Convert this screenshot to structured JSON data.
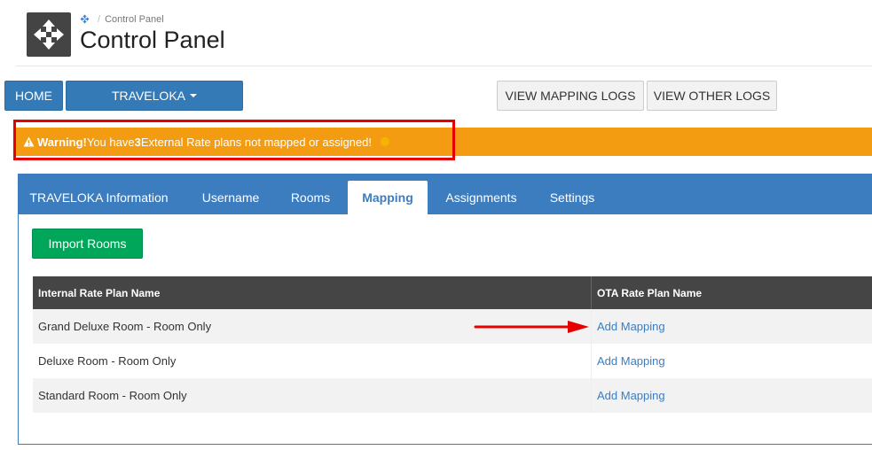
{
  "header": {
    "breadcrumb": "Control Panel",
    "title": "Control Panel",
    "logo_icon": "move-arrows-icon"
  },
  "nav": {
    "home_label": "HOME",
    "ota_label": "TRAVELOKA",
    "mapping_logs_label": "VIEW MAPPING LOGS",
    "other_logs_label": "VIEW OTHER LOGS"
  },
  "warning": {
    "title": "Warning!",
    "text_before": " You have ",
    "count": "3",
    "text_after": " External Rate plans not mapped or assigned!",
    "color": "#f39c12"
  },
  "tabs": [
    {
      "label": "TRAVELOKA Information"
    },
    {
      "label": "Username"
    },
    {
      "label": "Rooms"
    },
    {
      "label": "Mapping"
    },
    {
      "label": "Assignments"
    },
    {
      "label": "Settings"
    }
  ],
  "active_tab": "Mapping",
  "import_button_label": "Import Rooms",
  "table": {
    "headers": [
      "Internal Rate Plan Name",
      "OTA Rate Plan Name"
    ],
    "rows": [
      {
        "name": "Grand Deluxe Room - Room Only",
        "action": "Add Mapping"
      },
      {
        "name": "Deluxe Room - Room Only",
        "action": "Add Mapping"
      },
      {
        "name": "Standard Room - Room Only",
        "action": "Add Mapping"
      }
    ]
  },
  "colors": {
    "primary": "#337ab7",
    "panel_blue": "#3c7dc0",
    "success": "#00a65a",
    "annotation_red": "#e60000"
  }
}
